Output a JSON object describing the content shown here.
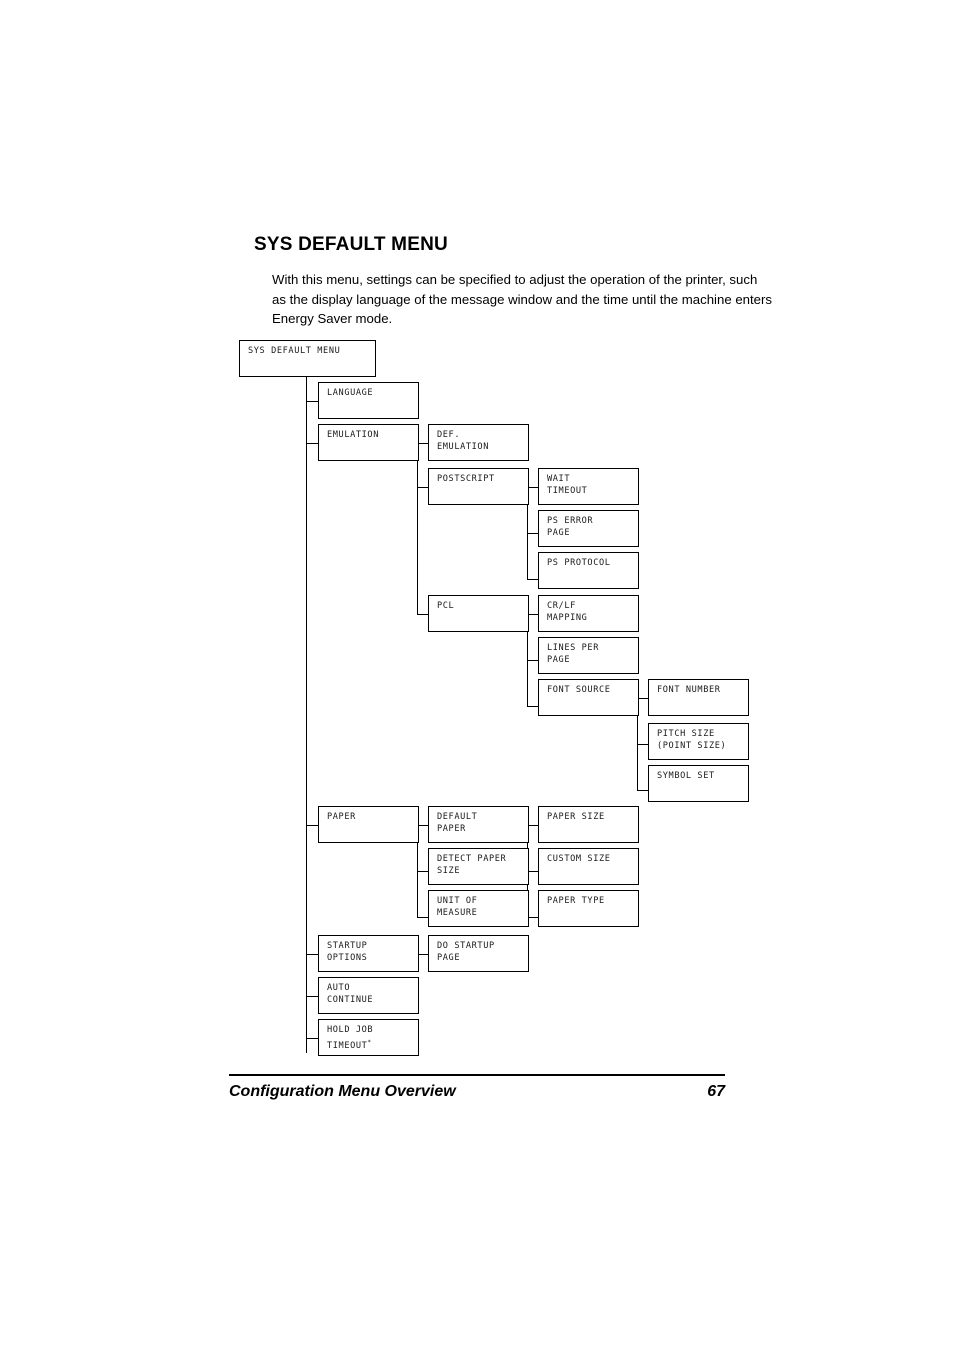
{
  "page": {
    "heading": "SYS DEFAULT MENU",
    "intro": "With this menu, settings can be specified to adjust the operation of the printer, such as the display language of the message window and the time until the machine enters Energy Saver mode.",
    "footer": {
      "title": "Configuration Menu Overview",
      "page_number": "67"
    }
  },
  "diagram": {
    "root": {
      "label": "SYS DEFAULT MENU"
    },
    "nodes": {
      "language": "LANGUAGE",
      "emulation": "EMULATION",
      "def_emulation": "DEF.\nEMULATION",
      "postscript": "POSTSCRIPT",
      "wait_timeout": "WAIT\nTIMEOUT",
      "ps_error_page": "PS ERROR\nPAGE",
      "ps_protocol": "PS PROTOCOL",
      "pcl": "PCL",
      "crlf_mapping": "CR/LF\nMAPPING",
      "lines_per_page": "LINES PER\nPAGE",
      "font_source": "FONT SOURCE",
      "font_number": "FONT NUMBER",
      "pitch_size": "PITCH SIZE\n(POINT SIZE)",
      "symbol_set": "SYMBOL SET",
      "paper": "PAPER",
      "default_paper": "DEFAULT\nPAPER",
      "paper_size": "PAPER SIZE",
      "detect_paper_size": "DETECT PAPER\nSIZE",
      "custom_size": "CUSTOM SIZE",
      "unit_of_measure": "UNIT OF\nMEASURE",
      "paper_type": "PAPER TYPE",
      "startup_options": "STARTUP\nOPTIONS",
      "do_startup_page": "DO STARTUP\nPAGE",
      "auto_continue": "AUTO\nCONTINUE",
      "hold_job_timeout": "HOLD JOB\nTIMEOUT",
      "hold_job_timeout_marker": "*"
    }
  }
}
